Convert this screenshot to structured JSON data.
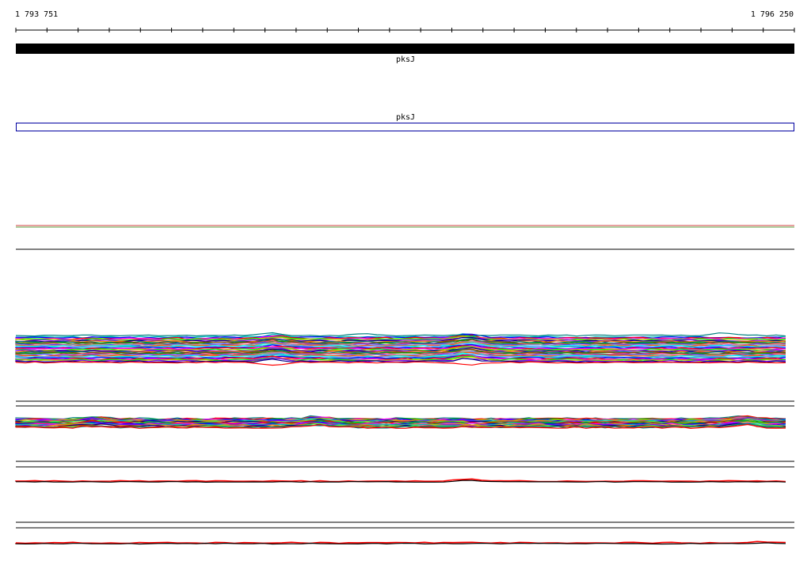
{
  "ruler": {
    "start_label": "1 793 751",
    "end_label": "1 796 250"
  },
  "genes": [
    {
      "name": "pksJ",
      "style": "filled",
      "color": "#000000"
    },
    {
      "name": "pksJ",
      "style": "outline",
      "color": "#0000a0"
    }
  ],
  "chart_data": {
    "type": "line",
    "title": "",
    "xlabel": "",
    "ylabel": "",
    "xlim": [
      1793751,
      1796250
    ],
    "tracks": [
      {
        "kind": "pair",
        "colors": [
          "#d04040",
          "#60a040"
        ]
      },
      {
        "kind": "baseline"
      },
      {
        "kind": "multi",
        "colors": [
          "#00c0c0",
          "#0000ff",
          "#ff0000",
          "#ff00ff",
          "#00ff00",
          "#c0c000",
          "#8000ff",
          "#000080",
          "#ff8000",
          "#008080",
          "#804000",
          "#00a000",
          "#ff4080",
          "#4040ff",
          "#a0a0a0",
          "#ff6000",
          "#00ffff",
          "#8080ff"
        ]
      },
      {
        "kind": "multi",
        "colors": [
          "#008080",
          "#ff0000",
          "#00c000",
          "#ff00ff",
          "#0000ff",
          "#c0c000",
          "#00c0c0",
          "#8000ff",
          "#ff8000",
          "#000080",
          "#40ff40",
          "#a04000"
        ]
      },
      {
        "kind": "pair",
        "colors": [
          "#000000",
          "#ff0000"
        ]
      },
      {
        "kind": "pair",
        "colors": [
          "#000000",
          "#ff0000"
        ]
      }
    ]
  }
}
